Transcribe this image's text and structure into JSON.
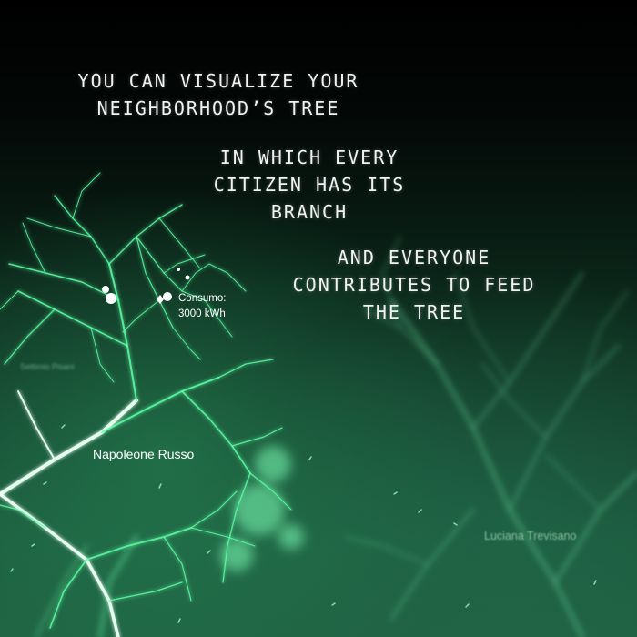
{
  "captions": {
    "first": [
      "YOU CAN VISUALIZE YOUR",
      "NEIGHBORHOOD’S TREE"
    ],
    "second": [
      "IN WHICH EVERY",
      "CITIZEN HAS ITS",
      "BRANCH"
    ],
    "third": [
      "AND EVERYONE",
      "CONTRIBUTES TO FEED",
      "THE TREE"
    ]
  },
  "labels": {
    "main_branch_name": "Napoleone Russo",
    "consumption_line1": "Consumo:",
    "consumption_line2": "3000 kWh",
    "blurred_branch_name": "Luciana Trevisano",
    "faint_branch_name": "Settimio Pisani"
  },
  "colors": {
    "branch": "#5dffa6",
    "branch_core": "#e9fff2",
    "background_top": "#000000",
    "background_bottom": "#1f6142"
  }
}
